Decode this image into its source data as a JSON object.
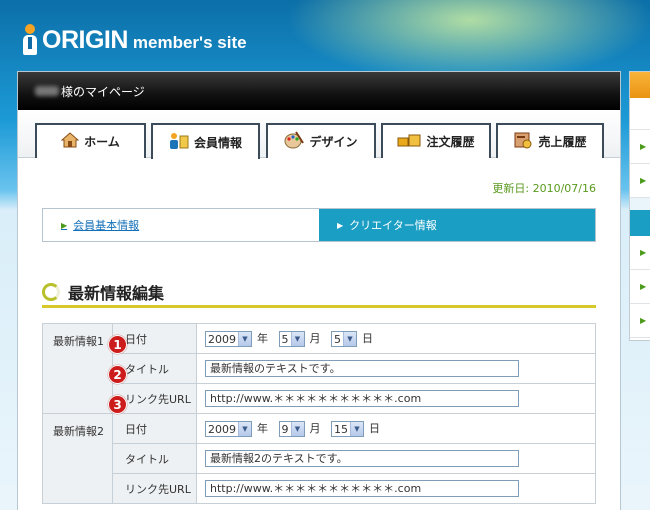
{
  "brand": {
    "name": "ORIGIN",
    "suffix": "member's site"
  },
  "user_bar": {
    "label": "様のマイページ"
  },
  "tabs": [
    {
      "label": "ホーム",
      "icon": "home-icon"
    },
    {
      "label": "会員情報",
      "icon": "member-info-icon"
    },
    {
      "label": "デザイン",
      "icon": "palette-icon"
    },
    {
      "label": "注文履歴",
      "icon": "order-history-icon"
    },
    {
      "label": "売上履歴",
      "icon": "sales-history-icon"
    }
  ],
  "updated": "更新日: 2010/07/16",
  "subnav": {
    "basic": "会員基本情報",
    "creator": "クリエイター情報"
  },
  "section_title": "最新情報編集",
  "news": [
    {
      "group": "最新情報1",
      "date_label": "日付",
      "year": "2009",
      "year_unit": "年",
      "month": "5",
      "month_unit": "月",
      "day": "5",
      "day_unit": "日",
      "title_label": "タイトル",
      "title_value": "最新情報のテキストです。",
      "url_label": "リンク先URL",
      "url_value": "http://www.＊＊＊＊＊＊＊＊＊＊＊.com"
    },
    {
      "group": "最新情報2",
      "date_label": "日付",
      "year": "2009",
      "year_unit": "年",
      "month": "9",
      "month_unit": "月",
      "day": "15",
      "day_unit": "日",
      "title_label": "タイトル",
      "title_value": "最新情報2のテキストです。",
      "url_label": "リンク先URL",
      "url_value": "http://www.＊＊＊＊＊＊＊＊＊＊＊.com"
    }
  ],
  "callouts": [
    "1",
    "2",
    "3"
  ],
  "colors": {
    "accent_blue": "#1a9ec4",
    "callout_red": "#cc1c1c",
    "updated_green": "#5a9a1e"
  }
}
